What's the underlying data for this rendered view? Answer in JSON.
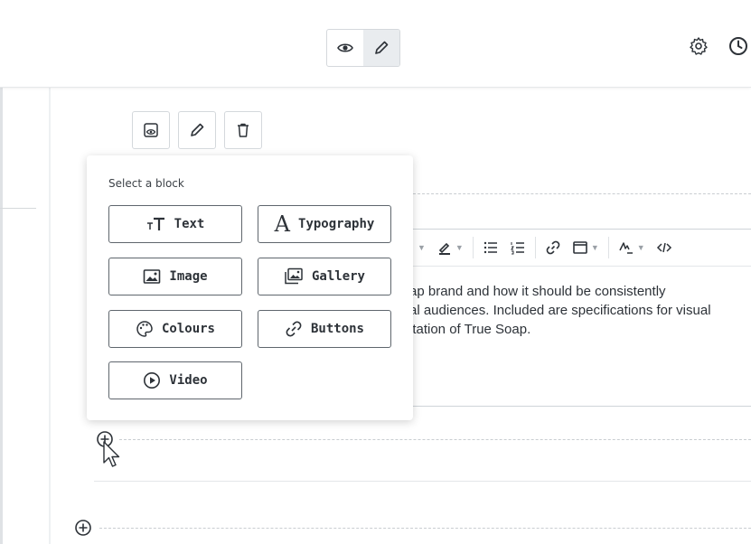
{
  "panel": {
    "title": "Select a block",
    "options": [
      {
        "label": "Text",
        "icon": "text-size-icon"
      },
      {
        "label": "Typography",
        "icon": "typography-icon"
      },
      {
        "label": "Image",
        "icon": "image-icon"
      },
      {
        "label": "Gallery",
        "icon": "gallery-icon"
      },
      {
        "label": "Colours",
        "icon": "palette-icon"
      },
      {
        "label": "Buttons",
        "icon": "link-icon"
      },
      {
        "label": "Video",
        "icon": "play-icon"
      }
    ]
  },
  "editor": {
    "lines": [
      "ap brand and how it should be consistently",
      "al audiences. Included are specifications for visual",
      "itation of True Soap."
    ]
  },
  "icons": {
    "view": "eye-icon",
    "edit": "pencil-icon",
    "settings": "gear-icon",
    "history": "clock-icon"
  },
  "colors": {
    "border": "#d4d8dc",
    "text": "#2d3238",
    "active_bg": "#e9ecef"
  }
}
